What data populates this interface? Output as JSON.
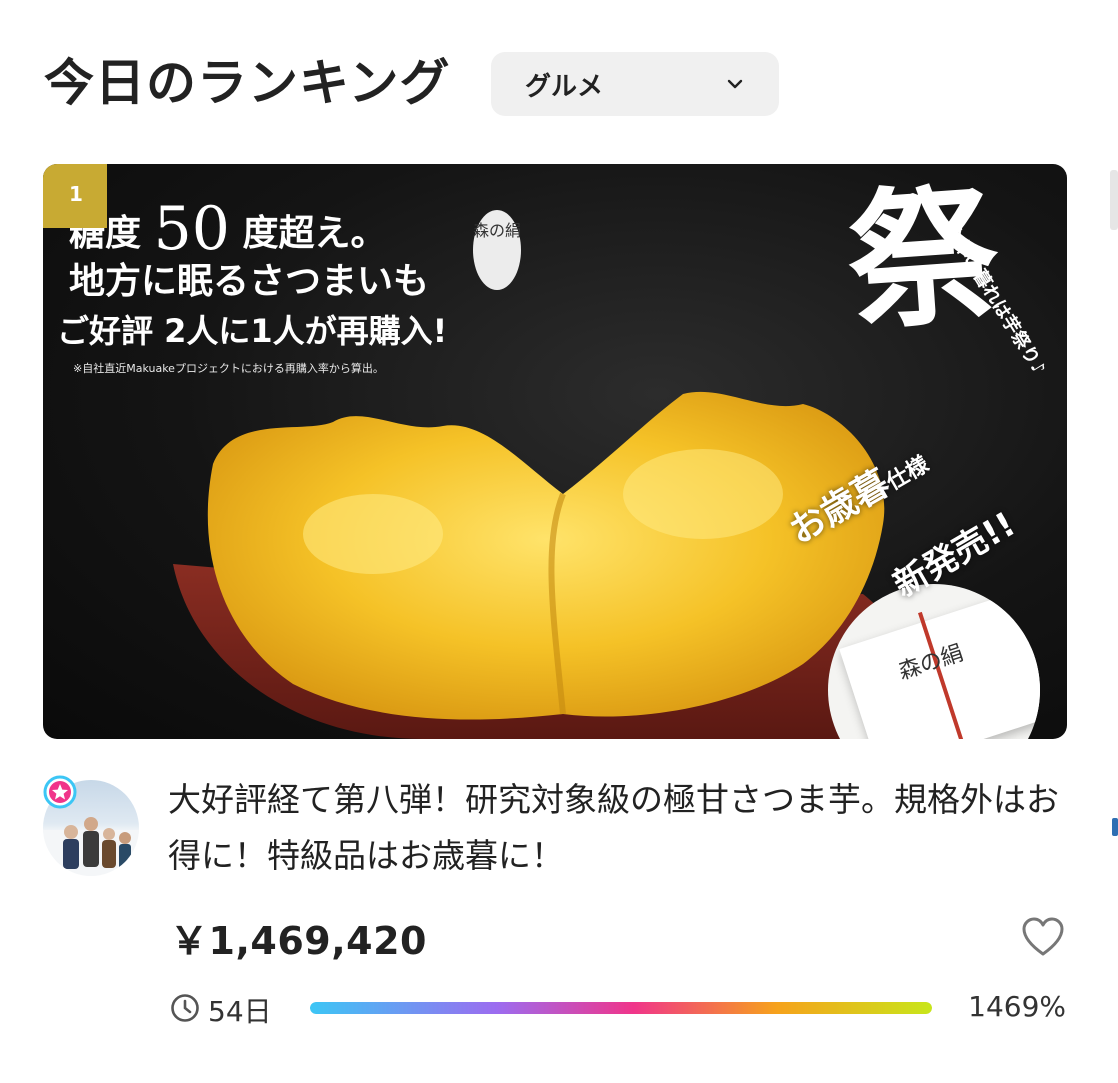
{
  "header": {
    "title": "今日のランキング",
    "category_selected": "グルメ"
  },
  "card": {
    "rank": "1",
    "image": {
      "line1_pre": "糖度",
      "line1_num": "50",
      "line1_post": "度超え。",
      "line2": "地方に眠るさつまいも",
      "line3": "ご好評  2人に1人が再購入!",
      "note": "※自社直近Makuakeプロジェクトにおける再購入率から算出。",
      "matsuri": "祭",
      "matsuri_sub": "今年の暮れは芋祭り♪",
      "logo_text": "森の絹",
      "seibo_main": "お歳暮",
      "seibo_small": "仕様",
      "new_release": "新発売!!",
      "box_logo": "森の絹"
    },
    "title": "大好評経て第八弾！研究対象級の極甘さつま芋。規格外はお得に！特級品はお歳暮に！",
    "amount": "￥1,469,420",
    "days_left": "54日",
    "percent_label": "1469%",
    "progress_fraction": 1.0
  },
  "colors": {
    "rank_badge": "#c8aa33",
    "select_bg": "#f0f0f0",
    "progress_gradient": [
      "#3cc6f5",
      "#9c6cf0",
      "#f0358a",
      "#f6a21c",
      "#c8e61b"
    ]
  },
  "icons": {
    "select": "chevron-down-icon",
    "like": "heart-icon",
    "time": "clock-icon",
    "owner_badge": "star-badge-icon"
  }
}
